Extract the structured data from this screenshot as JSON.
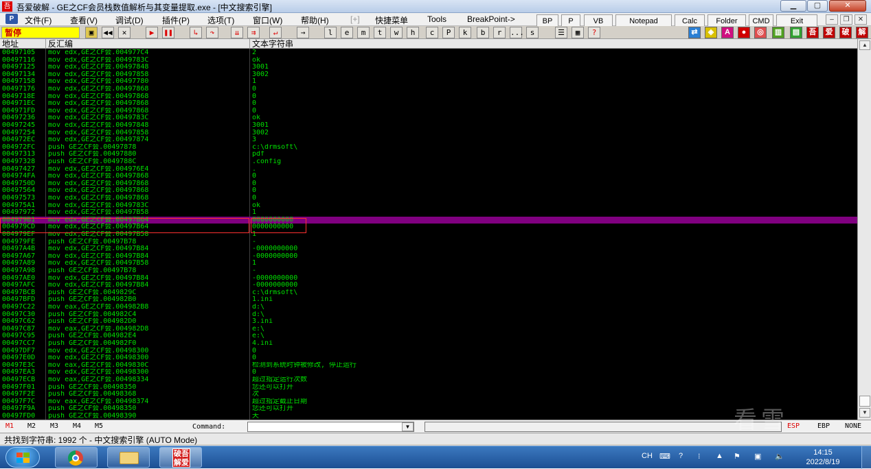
{
  "title": "吾爱破解 - GE之CF会员栈数值解析与其变量提取.exe - [中文搜索引擎]",
  "app_icon": "吾",
  "menu": [
    {
      "label": "文件(F)"
    },
    {
      "label": "查看(V)"
    },
    {
      "label": "调试(D)"
    },
    {
      "label": "插件(P)"
    },
    {
      "label": "选项(T)"
    },
    {
      "label": "窗口(W)"
    },
    {
      "label": "帮助(H)"
    },
    {
      "label": "[+]"
    },
    {
      "label": "快捷菜单"
    },
    {
      "label": "Tools"
    },
    {
      "label": "BreakPoint->"
    }
  ],
  "quick_buttons": [
    "BP",
    "P",
    "VB",
    "Notepad",
    "Calc",
    "Folder",
    "CMD",
    "Exit"
  ],
  "toolbar": {
    "status": "暂停",
    "letters": [
      "l",
      "e",
      "m",
      "t",
      "w",
      "h",
      "c",
      "P",
      "k",
      "b",
      "r",
      "...",
      "s"
    ]
  },
  "columns": {
    "address": "地址",
    "disasm": "反汇编",
    "text": "文本字符串"
  },
  "rows": [
    {
      "a": "00497105",
      "d": "mov edx,GE之CF会.004977C4",
      "s": "2"
    },
    {
      "a": "00497116",
      "d": "mov edx,GE之CF会.0049783C",
      "s": "ok"
    },
    {
      "a": "00497125",
      "d": "mov edx,GE之CF会.00497848",
      "s": "3001"
    },
    {
      "a": "00497134",
      "d": "mov edx,GE之CF会.00497858",
      "s": "3002"
    },
    {
      "a": "00497158",
      "d": "mov edx,GE之CF会.00497780",
      "s": "1"
    },
    {
      "a": "00497176",
      "d": "mov edx,GE之CF会.00497868",
      "s": "0"
    },
    {
      "a": "0049718E",
      "d": "mov edx,GE之CF会.00497868",
      "s": "0"
    },
    {
      "a": "004971EC",
      "d": "mov edx,GE之CF会.00497868",
      "s": "0"
    },
    {
      "a": "004971FD",
      "d": "mov edx,GE之CF会.00497868",
      "s": "0"
    },
    {
      "a": "00497236",
      "d": "mov edx,GE之CF会.0049783C",
      "s": "ok"
    },
    {
      "a": "00497245",
      "d": "mov edx,GE之CF会.00497848",
      "s": "3001"
    },
    {
      "a": "00497254",
      "d": "mov edx,GE之CF会.00497858",
      "s": "3002"
    },
    {
      "a": "004972EC",
      "d": "mov edx,GE之CF会.00497874",
      "s": "3"
    },
    {
      "a": "004972FC",
      "d": "push GE之CF会.00497878",
      "s": "c:\\drmsoft\\"
    },
    {
      "a": "00497313",
      "d": "push GE之CF会.00497880",
      "s": "pdf"
    },
    {
      "a": "00497328",
      "d": "push GE之CF会.0049788C",
      "s": ".config"
    },
    {
      "a": "00497427",
      "d": "mov edx,GE之CF会.004976E4",
      "s": "."
    },
    {
      "a": "004974FA",
      "d": "mov edx,GE之CF会.00497868",
      "s": "0"
    },
    {
      "a": "0049750D",
      "d": "mov edx,GE之CF会.00497868",
      "s": "0"
    },
    {
      "a": "00497564",
      "d": "mov edx,GE之CF会.00497868",
      "s": "0"
    },
    {
      "a": "00497573",
      "d": "mov edx,GE之CF会.00497868",
      "s": "0"
    },
    {
      "a": "004975A1",
      "d": "mov edx,GE之CF会.0049783C",
      "s": "ok"
    },
    {
      "a": "00497972",
      "d": "mov edx,GE之CF会.00497B58",
      "s": "1"
    },
    {
      "a": "004979B1",
      "d": "mov edx,GE之CF会.00497B64",
      "s": "0000000000",
      "sel": true
    },
    {
      "a": "004979CD",
      "d": "mov edx,GE之CF会.00497B64",
      "s": "0000000000"
    },
    {
      "a": "004979EF",
      "d": "mov edx,GE之CF会.00497B58",
      "s": "1"
    },
    {
      "a": "004979FE",
      "d": "push GE之CF会.00497B78",
      "s": "-"
    },
    {
      "a": "00497A4B",
      "d": "mov edx,GE之CF会.00497B84",
      "s": "-0000000000"
    },
    {
      "a": "00497A67",
      "d": "mov edx,GE之CF会.00497B84",
      "s": "-0000000000"
    },
    {
      "a": "00497A89",
      "d": "mov edx,GE之CF会.00497B58",
      "s": "1"
    },
    {
      "a": "00497A98",
      "d": "push GE之CF会.00497B78",
      "s": "-"
    },
    {
      "a": "00497AE0",
      "d": "mov edx,GE之CF会.00497B84",
      "s": "-0000000000"
    },
    {
      "a": "00497AFC",
      "d": "mov edx,GE之CF会.00497B84",
      "s": "-0000000000"
    },
    {
      "a": "00497BCB",
      "d": "push GE之CF会.0049829C",
      "s": "c:\\drmsoft\\"
    },
    {
      "a": "00497BFD",
      "d": "push GE之CF会.004982B0",
      "s": "1.ini"
    },
    {
      "a": "00497C22",
      "d": "mov eax,GE之CF会.004982B8",
      "s": "d:\\"
    },
    {
      "a": "00497C30",
      "d": "push GE之CF会.004982C4",
      "s": "d:\\"
    },
    {
      "a": "00497C62",
      "d": "push GE之CF会.004982D0",
      "s": "3.ini"
    },
    {
      "a": "00497C87",
      "d": "mov eax,GE之CF会.004982D8",
      "s": "e:\\"
    },
    {
      "a": "00497C95",
      "d": "push GE之CF会.004982E4",
      "s": "e:\\"
    },
    {
      "a": "00497CC7",
      "d": "push GE之CF会.004982F0",
      "s": "4.ini"
    },
    {
      "a": "00497DF7",
      "d": "mov edx,GE之CF会.00498300",
      "s": "0"
    },
    {
      "a": "00497E0D",
      "d": "mov edx,GE之CF会.00498300",
      "s": "0"
    },
    {
      "a": "00497E3C",
      "d": "mov eax,GE之CF会.0049830C",
      "s": "检测到系统时钟被修改, 停止运行"
    },
    {
      "a": "00497EA3",
      "d": "mov edx,GE之CF会.00498300",
      "s": "0"
    },
    {
      "a": "00497ECB",
      "d": "mov eax,GE之CF会.00498334",
      "s": "超过指定运行次数"
    },
    {
      "a": "00497F01",
      "d": "push GE之CF会.00498350",
      "s": "您还可以打开"
    },
    {
      "a": "00497F2E",
      "d": "push GE之CF会.00498368",
      "s": "次"
    },
    {
      "a": "00497F7C",
      "d": "mov eax,GE之CF会.00498374",
      "s": "超过指定截止日期"
    },
    {
      "a": "00497F9A",
      "d": "push GE之CF会.00498350",
      "s": "您还可以打开"
    },
    {
      "a": "00497FD0",
      "d": "push GE之CF会.00498390",
      "s": "天"
    }
  ],
  "command": {
    "marks": [
      "M1",
      "M2",
      "M3",
      "M4",
      "M5"
    ],
    "label": "Command:",
    "value": "",
    "registers": [
      "ESP",
      "EBP",
      "NONE"
    ]
  },
  "statusbar": "共找到字符串: 1992 个  -  中文搜索引擎  (AUTO Mode)",
  "watermark": "看雪",
  "taskbar": {
    "pojie_label": "破吾解爱",
    "lang": "CH",
    "time": "14:15",
    "date": "2022/8/19"
  },
  "colors": {
    "list_bg": "#000000",
    "list_text": "#00e000",
    "selection": "#800080",
    "highlight_border": "#ff3030"
  },
  "icons": [
    "app-icon",
    "minimize-icon",
    "maximize-icon",
    "close-icon",
    "run-icon",
    "pause-icon",
    "step-icon",
    "windows-flag-icon",
    "chrome-icon",
    "folder-icon"
  ]
}
